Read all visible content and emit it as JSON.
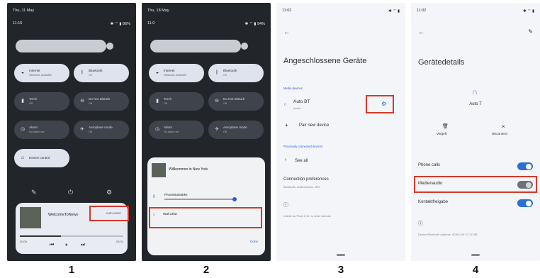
{
  "panel1": {
    "date": "Thu, 11 May",
    "time": "11:16",
    "battery": "86%",
    "tiles": [
      {
        "label": "Internet",
        "sub": "Networks available"
      },
      {
        "label": "Bluetooth",
        "sub": "On"
      },
      {
        "label": "Torch",
        "sub": "Off"
      },
      {
        "label": "Do Not Disturb",
        "sub": "Off"
      },
      {
        "label": "Alarm",
        "sub": "No alarm set"
      },
      {
        "label": "Aeroplane mode",
        "sub": "Off"
      },
      {
        "label": "Device control",
        "sub": ""
      }
    ],
    "media": {
      "title": "WelcomeToNewy",
      "cast_label": "Auto unnd",
      "time_start": "00:05",
      "time_end": "03:31"
    }
  },
  "panel2": {
    "date": "Thu, 18 May",
    "time": "11:0",
    "battery": "94%",
    "tiles": [
      {
        "label": "Internet",
        "sub": "Networks available"
      },
      {
        "label": "Bluetooth",
        "sub": "On"
      },
      {
        "label": "Torch",
        "sub": "Off"
      },
      {
        "label": "Do Not Disturb",
        "sub": "Off"
      },
      {
        "label": "Alarm",
        "sub": "No alarm set"
      },
      {
        "label": "Aeroplane mode",
        "sub": "Off"
      }
    ],
    "popup": {
      "title": "Willkommen in New York",
      "volume_label": "Phonelautstärke",
      "output": "Wal UND",
      "done": "Done"
    }
  },
  "panel3": {
    "status": "11:02",
    "heading": "Angeschlossene Geräte",
    "section_media": "Media devices",
    "device_name": "Auto BT",
    "device_sub": "Active",
    "pair": "Pair new device",
    "section_prev": "Previously connected devices",
    "see_all": "See all",
    "pref": "Connection preferences",
    "pref_sub": "Bluetooth, Android Auto, NFC",
    "footer": "Visible as 'Pixel 3 XL' to other devices"
  },
  "panel4": {
    "status": "11:02",
    "heading": "Gerätedetails",
    "device": "Auto T",
    "forget": "Vergeß",
    "disconnect": "Disconnect",
    "phone_calls": "Phone calls",
    "media_audio": "Medienaudio",
    "contacts": "Kontaktfreigabe",
    "footer": "Device Bluetooth address: 4D:B1:D5:7C:7C:0B"
  },
  "labels": [
    "1",
    "2",
    "3",
    "4"
  ]
}
